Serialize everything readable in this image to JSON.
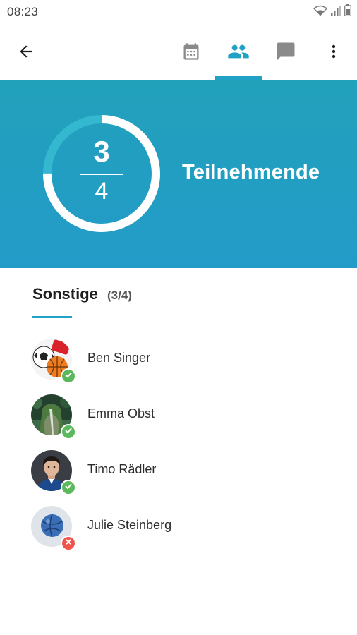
{
  "status_bar": {
    "time": "08:23",
    "icons": [
      "wifi-icon",
      "signal-icon",
      "battery-icon"
    ]
  },
  "app_bar": {
    "back_icon": "arrow-back-icon",
    "tabs": [
      {
        "id": "calendar",
        "icon": "calendar-icon",
        "selected": false
      },
      {
        "id": "participants",
        "icon": "people-icon",
        "selected": true
      },
      {
        "id": "chat",
        "icon": "chat-bubble-icon",
        "selected": false
      }
    ],
    "more_icon": "more-vertical-icon"
  },
  "summary": {
    "confirmed": "3",
    "total": "4",
    "progress": 0.75,
    "label": "Teilnehmende"
  },
  "section": {
    "title": "Sonstige",
    "count": "(3/4)"
  },
  "participants": [
    {
      "name": "Ben Singer",
      "status": "confirmed",
      "avatar": "sports-balls-avatar"
    },
    {
      "name": "Emma Obst",
      "status": "confirmed",
      "avatar": "jungle-waterfall-avatar"
    },
    {
      "name": "Timo Rädler",
      "status": "confirmed",
      "avatar": "man-portrait-avatar"
    },
    {
      "name": "Julie Steinberg",
      "status": "declined",
      "avatar": "handball-avatar"
    }
  ],
  "colors": {
    "accent": "#21a2c4",
    "hero_top": "#22a1bb",
    "hero_bottom": "#239bc9",
    "confirmed": "#5cb85c",
    "declined": "#f0544c"
  }
}
